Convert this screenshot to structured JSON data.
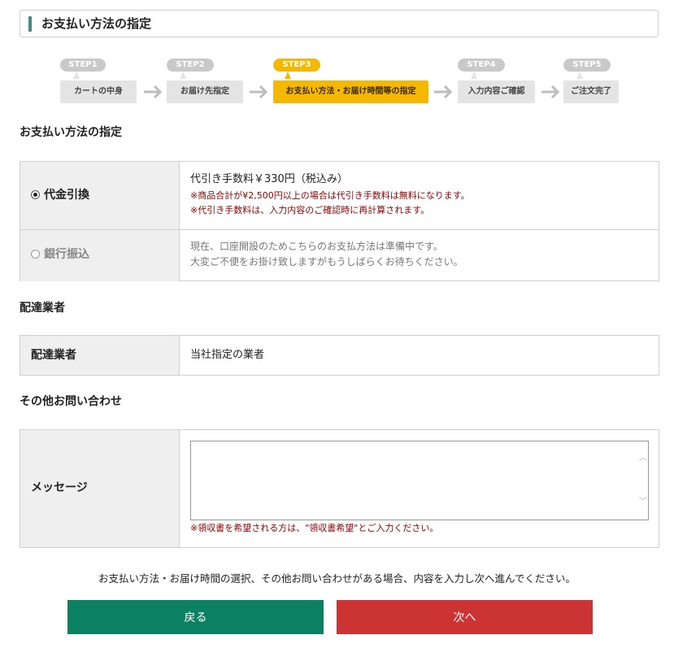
{
  "page_title": "お支払い方法の指定",
  "steps": [
    {
      "tag": "STEP1",
      "label": "カートの中身",
      "active": false
    },
    {
      "tag": "STEP2",
      "label": "お届け先指定",
      "active": false
    },
    {
      "tag": "STEP3",
      "label": "お支払い方法・お届け時間等の指定",
      "active": true
    },
    {
      "tag": "STEP4",
      "label": "入力内容ご確認",
      "active": false
    },
    {
      "tag": "STEP5",
      "label": "ご注文完了",
      "active": false
    }
  ],
  "payment": {
    "heading": "お支払い方法の指定",
    "cod": {
      "label": "代金引換",
      "selected": true,
      "fee": "代引き手数料￥330円（税込み）",
      "note1": "※商品合計が¥2,500円以上の場合は代引き手数料は無料になります。",
      "note2": "※代引き手数料は、入力内容のご確認時に再計算されます。"
    },
    "bank": {
      "label": "銀行振込",
      "disabled": true,
      "text1": "現在、口座開設のためこちらのお支払方法は準備中です。",
      "text2": "大変ご不便をお掛け致しますがもうしばらくお待ちください。"
    }
  },
  "delivery": {
    "heading": "配達業者",
    "label": "配達業者",
    "value": "当社指定の業者"
  },
  "inquiry": {
    "heading": "その他お問い合わせ",
    "label": "メッセージ",
    "message_value": "",
    "note": "※領収書を希望される方は、\"領収書希望\"とご入力ください。"
  },
  "info_text": "お支払い方法・お届け時間の選択、その他お問い合わせがある場合、内容を入力し次へ進んでください。",
  "buttons": {
    "back": "戻る",
    "next": "次へ"
  },
  "colors": {
    "accent_bar": "#3f8e86",
    "active_step": "#f5b800",
    "back_button": "#0c8062",
    "next_button": "#cc3333",
    "note_text": "#8b0000"
  }
}
